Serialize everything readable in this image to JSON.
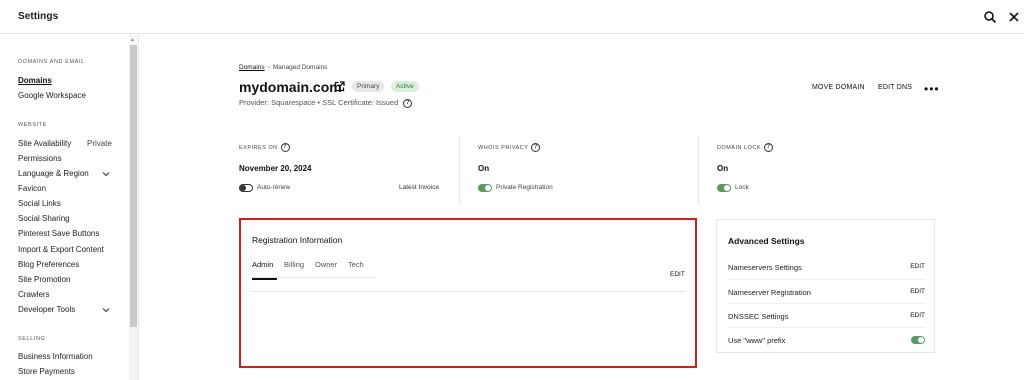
{
  "app": {
    "title": "Settings"
  },
  "sidebar": {
    "sections": [
      {
        "label": "DOMAINS AND EMAIL",
        "items": [
          "Domains",
          "Google Workspace"
        ]
      },
      {
        "label": "WEBSITE",
        "items": [
          "Site Availability",
          "Permissions",
          "Language & Region",
          "Favicon",
          "Social Links",
          "Social Sharing",
          "Pinterest Save Buttons",
          "Import & Export Content",
          "Blog Preferences",
          "Site Promotion",
          "Crawlers",
          "Developer Tools"
        ]
      },
      {
        "label": "SELLING",
        "items": [
          "Business Information",
          "Store Payments"
        ]
      }
    ],
    "site_availability_status": "Private",
    "active_item": "Domains"
  },
  "breadcrumb": {
    "root": "Domains",
    "separator": "›",
    "current": "Managed Domains"
  },
  "domain": {
    "name": "mydomain.com",
    "badges": {
      "primary": "Primary",
      "active": "Active"
    },
    "provider_text": "Provider: Squarespace",
    "bullet": "•",
    "ssl_text": "SSL Certificate: Issued"
  },
  "actions": {
    "move_domain": "MOVE DOMAIN",
    "edit_dns": "EDIT DNS",
    "more": "•••"
  },
  "info": {
    "expires": {
      "label": "EXPIRES ON",
      "value": "November 20, 2024",
      "toggle_label": "Auto-renew",
      "toggle_on": false,
      "link": "Latest Invoice"
    },
    "whois": {
      "label": "WHOIS PRIVACY",
      "value": "On",
      "toggle_label": "Private Registration",
      "toggle_on": true
    },
    "lock": {
      "label": "DOMAIN LOCK",
      "value": "On",
      "toggle_label": "Lock",
      "toggle_on": true
    }
  },
  "registration": {
    "title": "Registration Information",
    "tabs": [
      "Admin",
      "Billing",
      "Owner",
      "Tech"
    ],
    "active_tab": "Admin",
    "edit_label": "EDIT"
  },
  "advanced": {
    "title": "Advanced Settings",
    "rows": [
      {
        "label": "Nameservers Settings",
        "action": "EDIT"
      },
      {
        "label": "Nameserver Registration",
        "action": "EDIT"
      },
      {
        "label": "DNSSEC Settings",
        "action": "EDIT"
      },
      {
        "label": "Use \"www\" prefix",
        "toggle_on": true
      }
    ]
  },
  "icons": {
    "search": "search-icon",
    "close": "close-icon",
    "external": "external-link-icon",
    "help": "help-icon",
    "chevron": "chevron-down-icon"
  },
  "colors": {
    "accent_green": "#5a9a63",
    "active_badge_bg": "#dbefdc",
    "highlight_border": "#d11f1f"
  },
  "help_glyph": "?",
  "scroll_glyph": "▲"
}
